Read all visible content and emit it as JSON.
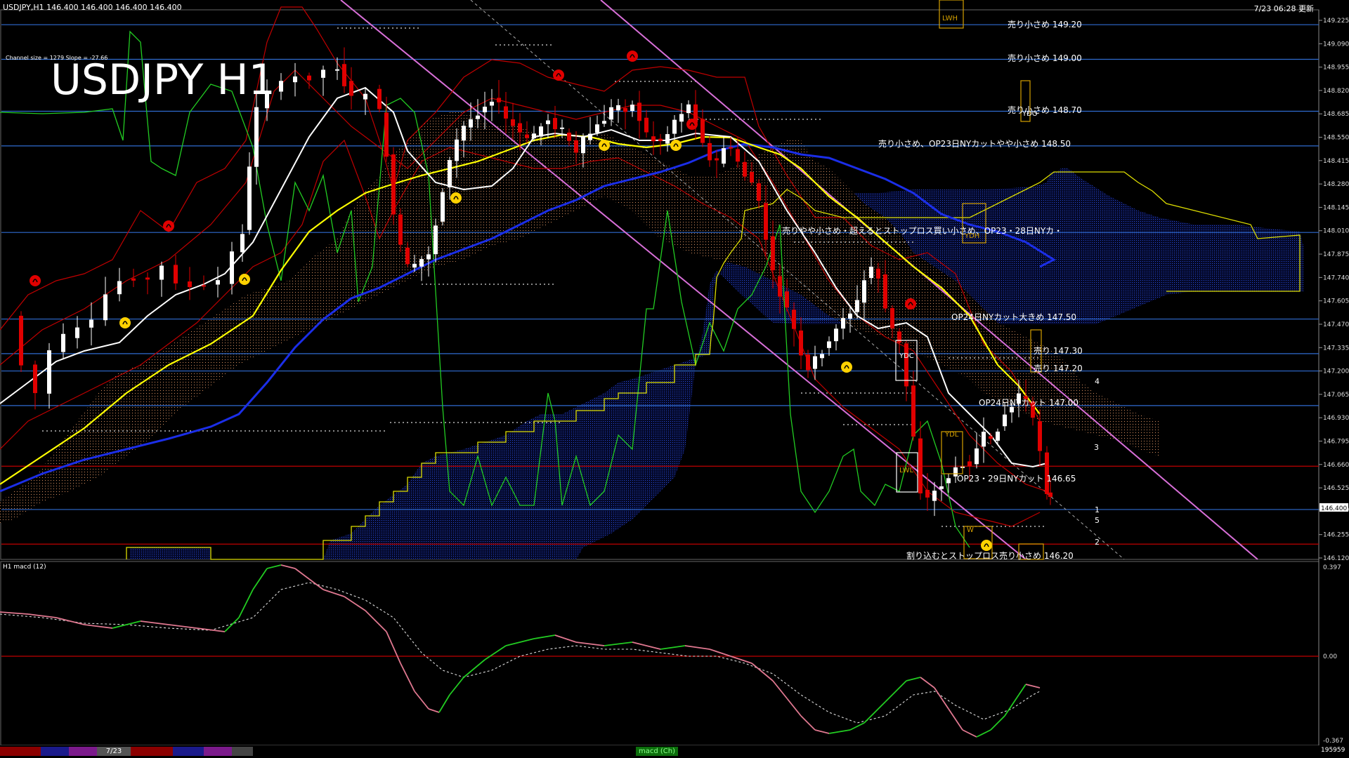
{
  "header": {
    "symbol_info": "USDJPY,H1   146.400 146.400 146.400 146.400",
    "datetime": "7/23 06:28 更新"
  },
  "chart": {
    "title": "USDJPY H1",
    "channel_info": "Channel size = 1279 Slope = -27.66",
    "price_ticks": [
      "149.225",
      "149.090",
      "148.955",
      "148.820",
      "148.685",
      "148.550",
      "148.415",
      "148.280",
      "148.145",
      "148.010",
      "147.875",
      "147.740",
      "147.605",
      "147.470",
      "147.335",
      "147.200",
      "147.065",
      "146.930",
      "146.795",
      "146.660",
      "146.525",
      "146.400",
      "146.255",
      "146.120"
    ],
    "current_price": "146.400",
    "annotations": [
      "売り小さめ 149.20",
      "売り小さめ 149.00",
      "売り小さめ 148.70",
      "売り小さめ、OP23日NYカットやや小さめ 148.50",
      "売りやや小さめ・超えるとストップロス買い小さめ、OP23・28日NYカ・",
      "OP24日NYカット大きめ 147.50",
      "売り 147.30",
      "売り 147.20",
      "OP24日NYカット 147.00",
      "OP23・29日NYカット 146.65",
      "割り込むとストップロス売り小さめ 146.20"
    ],
    "box_labels": [
      "LWH",
      "YDH",
      "YDO",
      "YDC",
      "LWL",
      "YDL",
      "W"
    ],
    "channel_numbers": [
      "4",
      "3",
      "1",
      "5",
      "2"
    ],
    "colors": {
      "hline": "#2f6bd0",
      "redline": "#c00000",
      "bull": "#ffffff",
      "bear": "#e00000",
      "sma_yellow": "#ffff00",
      "sma_blue": "#1b2ee8",
      "sma_white": "#ffffff",
      "channel": "#e070e0",
      "kumo_blue": "#1a3cc0",
      "kumo_orange": "#e8a060",
      "rsi_green": "#22cc22"
    }
  },
  "macd": {
    "label": "H1  macd (12)",
    "ticks": [
      "0.397",
      "0.00",
      "-0.367"
    ]
  },
  "footer": {
    "date_tab": "7/23",
    "macd_tab": "macd (Ch)",
    "count": "195959"
  }
}
